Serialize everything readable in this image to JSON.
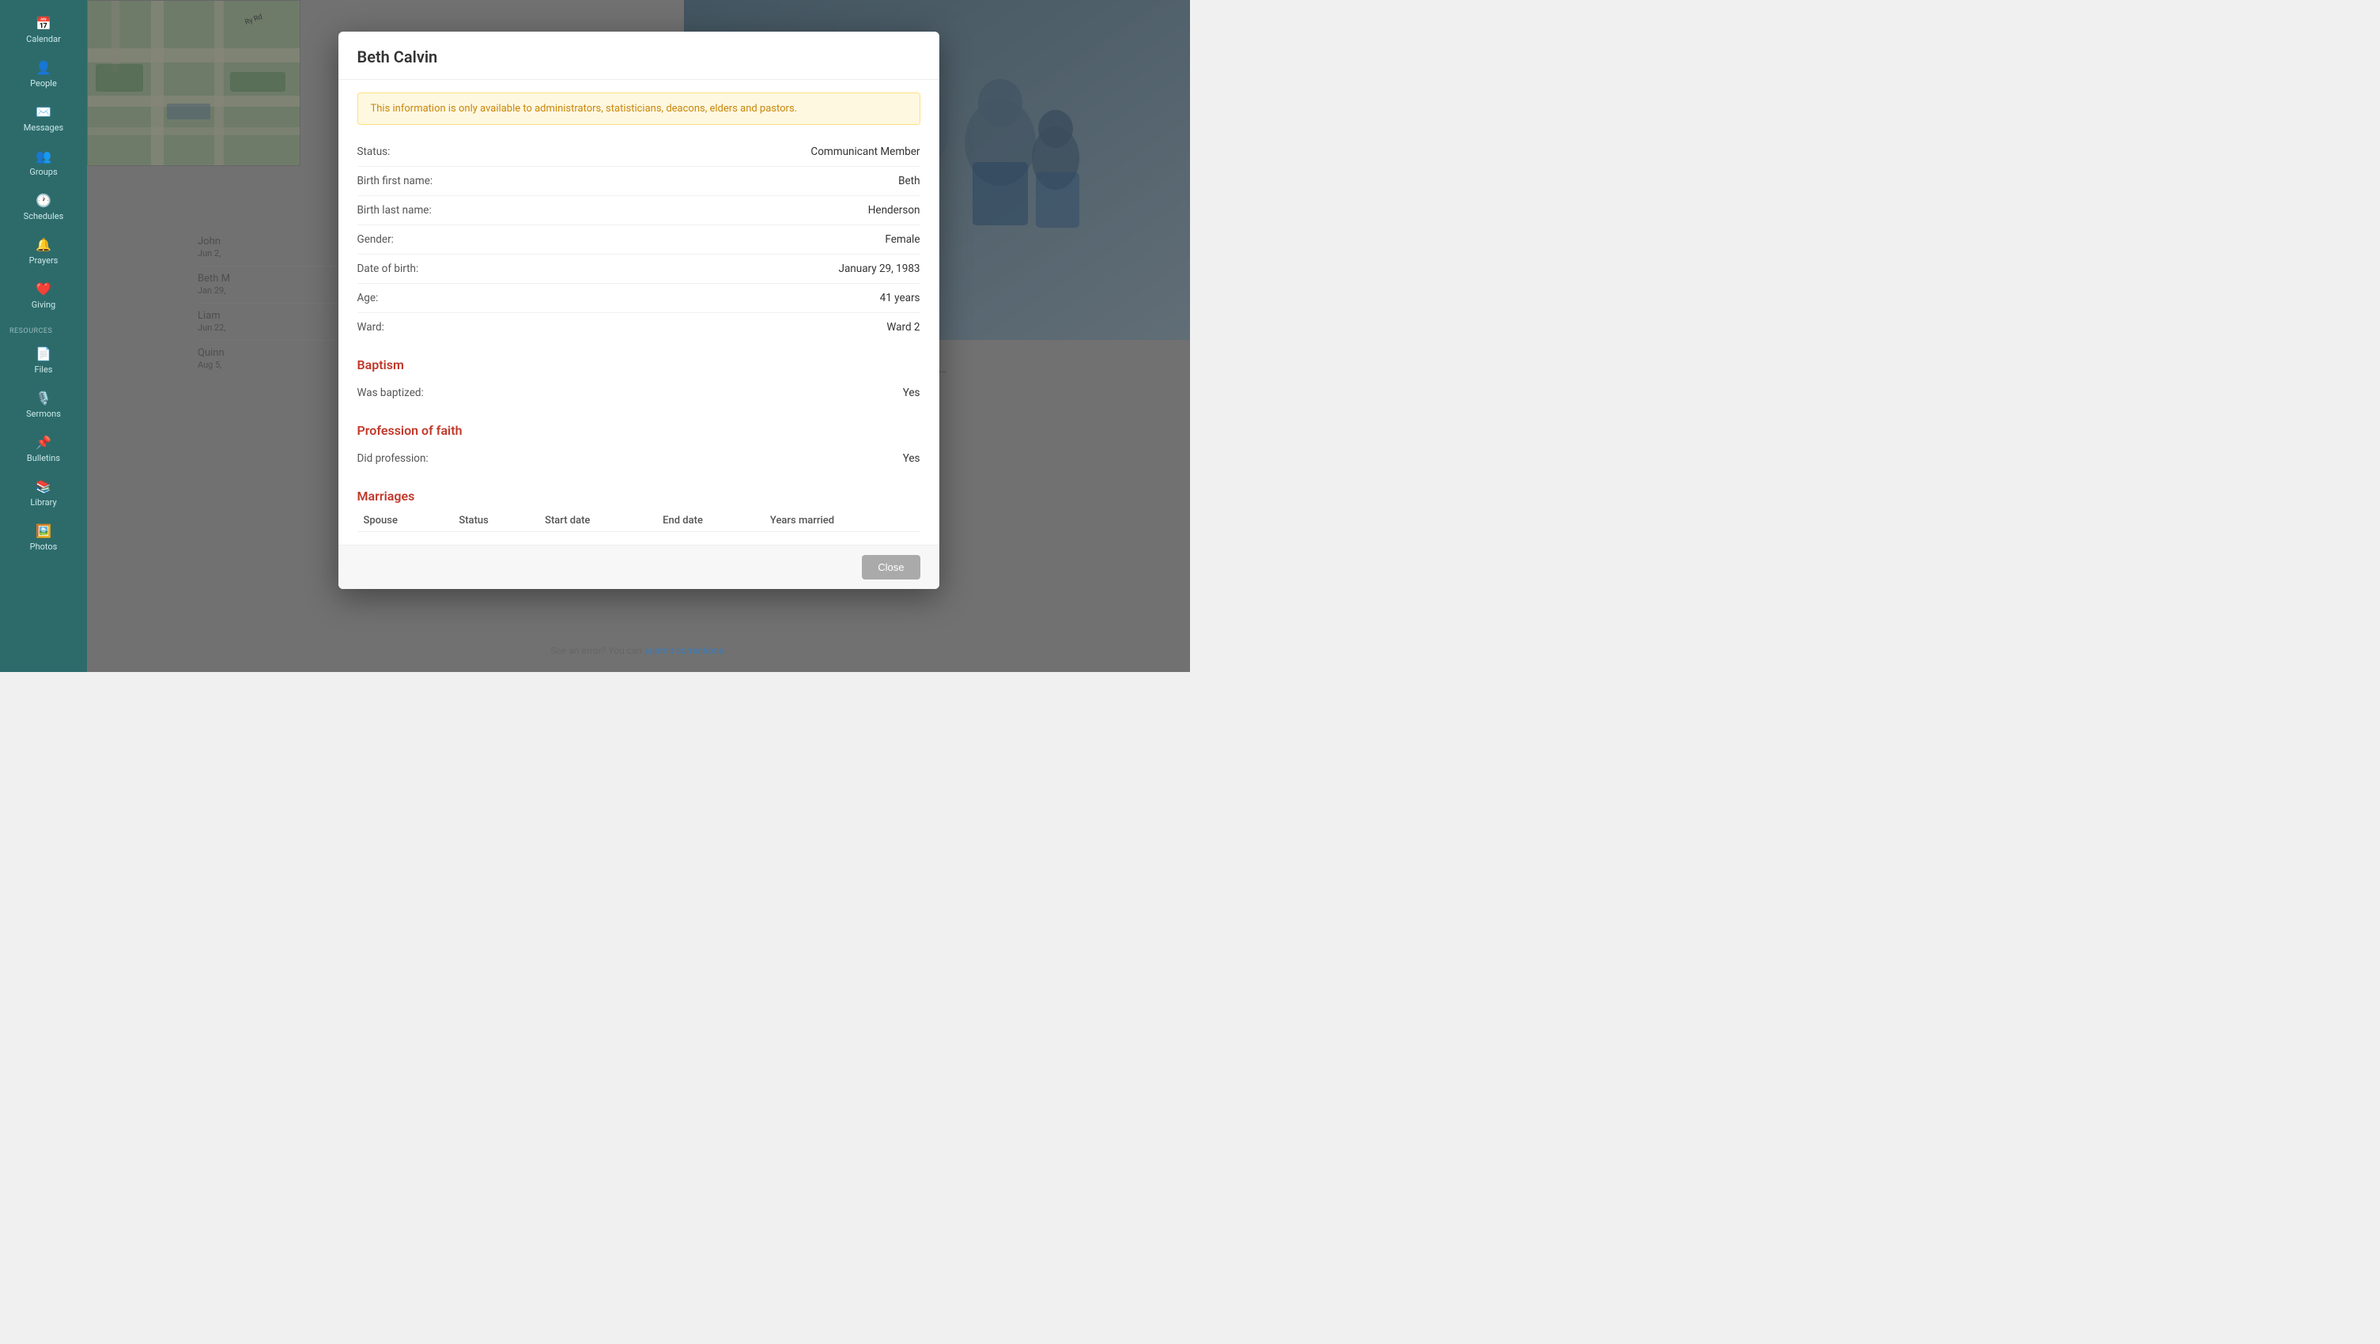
{
  "sidebar": {
    "items": [
      {
        "id": "calendar",
        "label": "Calendar",
        "icon": "📅"
      },
      {
        "id": "people",
        "label": "People",
        "icon": "👤"
      },
      {
        "id": "messages",
        "label": "Messages",
        "icon": "✉️"
      },
      {
        "id": "groups",
        "label": "Groups",
        "icon": "👥"
      },
      {
        "id": "schedules",
        "label": "Schedules",
        "icon": "🕐"
      },
      {
        "id": "prayers",
        "label": "Prayers",
        "icon": "🔔"
      },
      {
        "id": "giving",
        "label": "Giving",
        "icon": "❤️"
      }
    ],
    "resources_label": "RESOURCES",
    "resource_items": [
      {
        "id": "files",
        "label": "Files",
        "icon": "📄"
      },
      {
        "id": "sermons",
        "label": "Sermons",
        "icon": "🎙️"
      },
      {
        "id": "bulletins",
        "label": "Bulletins",
        "icon": "📌"
      },
      {
        "id": "library",
        "label": "Library",
        "icon": "📚"
      },
      {
        "id": "photos",
        "label": "Photos",
        "icon": "🖼️"
      }
    ]
  },
  "modal": {
    "title": "Beth Calvin",
    "warning": "This information is only available to administrators, statisticians, deacons, elders and pastors.",
    "fields": [
      {
        "label": "Status:",
        "value": "Communicant Member"
      },
      {
        "label": "Birth first name:",
        "value": "Beth"
      },
      {
        "label": "Birth last name:",
        "value": "Henderson"
      },
      {
        "label": "Gender:",
        "value": "Female"
      },
      {
        "label": "Date of birth:",
        "value": "January 29, 1983"
      },
      {
        "label": "Age:",
        "value": "41 years"
      },
      {
        "label": "Ward:",
        "value": "Ward 2"
      }
    ],
    "baptism": {
      "heading": "Baptism",
      "fields": [
        {
          "label": "Was baptized:",
          "value": "Yes"
        }
      ]
    },
    "profession": {
      "heading": "Profession of faith",
      "fields": [
        {
          "label": "Did profession:",
          "value": "Yes"
        }
      ]
    },
    "marriages": {
      "heading": "Marriages",
      "columns": [
        "Spouse",
        "Status",
        "Start date",
        "End date",
        "Years married"
      ]
    },
    "close_label": "Close"
  },
  "footer": {
    "text": "See an error? You can ",
    "link_text": "submit corrections",
    "suffix": "."
  }
}
